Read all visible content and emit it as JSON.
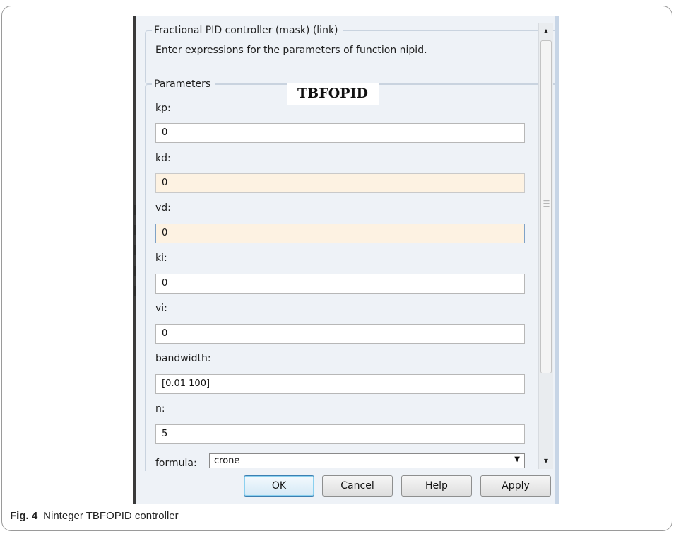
{
  "dialog": {
    "title": "Fractional PID controller (mask) (link)",
    "description": "Enter expressions for the parameters of function nipid."
  },
  "parameters": {
    "group_title": "Parameters",
    "overlay_label": "TBFOPID",
    "fields": [
      {
        "label": "kp:",
        "value": "0"
      },
      {
        "label": "kd:",
        "value": "0"
      },
      {
        "label": "vd:",
        "value": "0"
      },
      {
        "label": "ki:",
        "value": "0"
      },
      {
        "label": "vi:",
        "value": "0"
      },
      {
        "label": "bandwidth:",
        "value": "[0.01 100]"
      },
      {
        "label": "n:",
        "value": "5"
      }
    ],
    "formula": {
      "label": "formula:",
      "value": "crone"
    }
  },
  "buttons": {
    "ok": "OK",
    "cancel": "Cancel",
    "help": "Help",
    "apply": "Apply"
  },
  "caption": {
    "number": "Fig. 4",
    "text": "Ninteger TBFOPID controller"
  },
  "icons": {
    "scroll_up": "scroll-up-arrow",
    "scroll_down": "scroll-down-arrow",
    "dropdown": "chevron-down"
  },
  "colors": {
    "dialog_bg": "#eef2f7",
    "highlight_field": "#fdf2e2",
    "default_button_border": "#3c7fb1"
  }
}
